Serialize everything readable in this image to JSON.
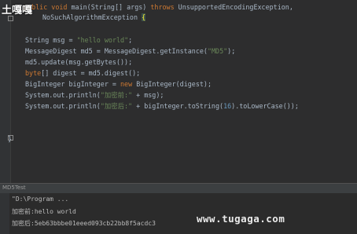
{
  "watermark_top_left": "土嘎嘎",
  "watermark_bottom_right": "www.tugaga.com",
  "code": {
    "line1_kw1": "public void ",
    "line1_rest": "main(String[] args) ",
    "line1_kw2": "throws ",
    "line1_exc": "UnsupportedEncodingException,",
    "line2": "NoSuchAlgorithmException ",
    "line2_brace": "{",
    "line3_type": "String msg = ",
    "line3_str": "\"hello world\"",
    "line3_end": ";",
    "line4_a": "MessageDigest md5 = MessageDigest.getInstance(",
    "line4_str": "\"MD5\"",
    "line4_end": ");",
    "line5": "md5.update(msg.getBytes());",
    "line6_a": "byte",
    "line6_b": "[] digest = md5.digest();",
    "line7_a": "BigInteger bigInteger = ",
    "line7_kw": "new ",
    "line7_b": "BigInteger(digest);",
    "line8_a": "System.out.println(",
    "line8_str": "\"加密前:\"",
    "line8_b": " + msg);",
    "line9_a": "System.out.println(",
    "line9_str": "\"加密后:\"",
    "line9_b": " + bigInteger.toString(",
    "line9_num": "16",
    "line9_c": ").toLowerCase());",
    "line10": "}"
  },
  "panel": {
    "tab": "MD5Test"
  },
  "console": {
    "line1": "\"D:\\Program ...",
    "line2": "加密前:hello world",
    "line3": "加密后:5eb63bbbe01eeed093cb22bb8f5acdc3"
  }
}
